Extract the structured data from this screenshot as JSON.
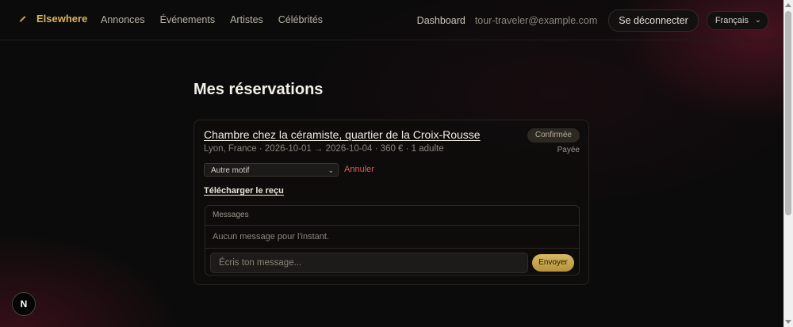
{
  "header": {
    "brand": "Elsewhere",
    "nav": [
      "Annonces",
      "Événements",
      "Artistes",
      "Célébrités"
    ],
    "dashboard": "Dashboard",
    "email": "tour-traveler@example.com",
    "logout_label": "Se déconnecter",
    "language": "Français"
  },
  "main": {
    "title": "Mes réservations",
    "reservation": {
      "listing_title": "Chambre chez la céramiste, quartier de la Croix-Rousse",
      "meta": "Lyon, France · 2026-10-01 → 2026-10-04 · 360 € · 1 adulte",
      "status": "Confirmée",
      "payment": "Payée",
      "cancel_reason": "Autre motif",
      "cancel_label": "Annuler",
      "receipt_label": "Télécharger le reçu"
    },
    "messages": {
      "header": "Messages",
      "empty": "Aucun message pour l'instant.",
      "placeholder": "Écris ton message...",
      "send_label": "Envoyer"
    }
  },
  "dev_badge": "N"
}
